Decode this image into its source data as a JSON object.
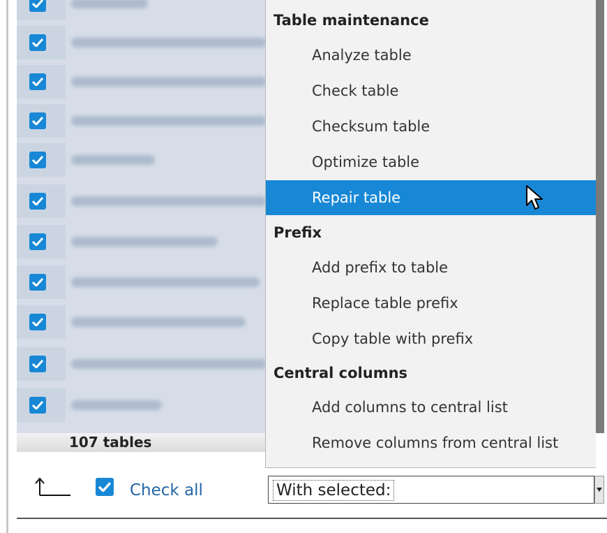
{
  "colors": {
    "accent": "#1888d6",
    "link": "#2466a6",
    "menu_background": "#f2f2f2",
    "table_background": "#d6dde8"
  },
  "table_list": {
    "rows": [
      {
        "checked": true,
        "name": ""
      },
      {
        "checked": true,
        "name": ""
      },
      {
        "checked": true,
        "name": ""
      },
      {
        "checked": true,
        "name": ""
      },
      {
        "checked": true,
        "name": ""
      },
      {
        "checked": true,
        "name": ""
      },
      {
        "checked": true,
        "name": ""
      },
      {
        "checked": true,
        "name": ""
      },
      {
        "checked": true,
        "name": ""
      },
      {
        "checked": true,
        "name": ""
      },
      {
        "checked": true,
        "name": ""
      }
    ],
    "footer_count": "107 tables"
  },
  "bulk_actions": {
    "arrow_icon": "corner-up-arrow-icon",
    "check_all_label": "Check all",
    "check_all_checked": true,
    "select_value": "With selected:"
  },
  "dropdown_menu": {
    "groups": [
      {
        "label": "Table maintenance",
        "items": [
          "Analyze table",
          "Check table",
          "Checksum table",
          "Optimize table",
          "Repair table"
        ]
      },
      {
        "label": "Prefix",
        "items": [
          "Add prefix to table",
          "Replace table prefix",
          "Copy table with prefix"
        ]
      },
      {
        "label": "Central columns",
        "items": [
          "Add columns to central list",
          "Remove columns from central list"
        ]
      }
    ],
    "highlighted_item": "Repair table"
  },
  "cursor_icon": "mouse-pointer-icon"
}
